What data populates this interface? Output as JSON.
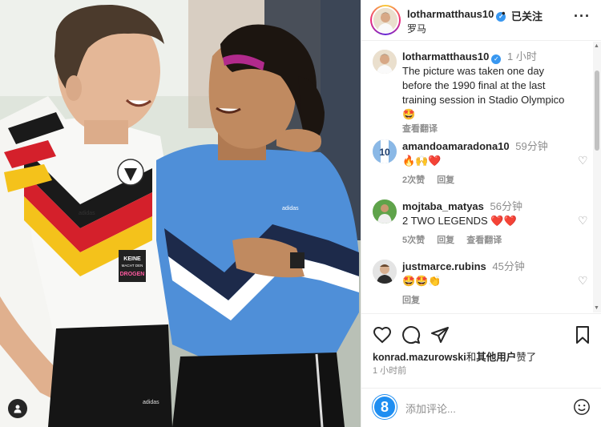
{
  "header": {
    "username": "lotharmatthaus10",
    "separator": "•",
    "follow_label": "已关注",
    "location": "罗马",
    "more_icon": "more-dots-icon"
  },
  "caption": {
    "username": "lotharmatthaus10",
    "time": "1 小时",
    "text": "The picture was taken one day before the 1990 final at the last training session in Stadio Olympico",
    "emoji": "🤩",
    "translate": "查看翻译"
  },
  "comments": [
    {
      "username": "amandoamaradona10",
      "time": "59分钟",
      "text": "🔥🙌❤️",
      "likes": "2次赞",
      "reply": "回复",
      "translate": ""
    },
    {
      "username": "mojtaba_matyas",
      "time": "56分钟",
      "text": "2 TWO LEGENDS ❤️❤️",
      "likes": "5次赞",
      "reply": "回复",
      "translate": "查看翻译"
    },
    {
      "username": "justmarce.rubins",
      "time": "45分钟",
      "text": "🤩🤩👏",
      "likes": "",
      "reply": "回复",
      "translate": ""
    }
  ],
  "likes_line": {
    "user": "konrad.mazurowski",
    "joiner": "和",
    "others": "其他用户",
    "suffix": "赞了"
  },
  "posted_ago": "1 小时前",
  "add_comment": {
    "avatar_letter": "8",
    "placeholder": "添加评论..."
  },
  "photo": {
    "jersey_text_1": "KEINE",
    "jersey_text_2": "MACHT DEN",
    "jersey_text_3": "DROGEN",
    "shirt_brand_left": "adidas",
    "shirt_brand_right": "adidas",
    "shorts_brand": "adidas"
  }
}
